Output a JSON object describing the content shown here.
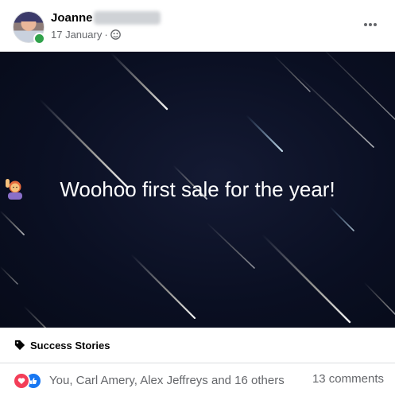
{
  "post": {
    "author": {
      "name": "Joanne"
    },
    "date": "17 January",
    "separator": "·",
    "audience_icon": "friends-icon",
    "more_icon": "more-options-icon",
    "media": {
      "caption": "Woohoo first sale for the year!",
      "emoji": "person-raising-hand-emoji",
      "background": "#0a0f22"
    },
    "topic": {
      "icon": "tag-icon",
      "label": "Success Stories"
    },
    "reactions": {
      "icons": [
        "love-icon",
        "like-icon"
      ],
      "text": "You, Carl Amery, Alex Jeffreys and 16 others"
    },
    "comments": "13 comments",
    "colors": {
      "online": "#31a24c",
      "love": "#f33e58",
      "like": "#1877f2",
      "secondary_text": "#65676b"
    }
  }
}
